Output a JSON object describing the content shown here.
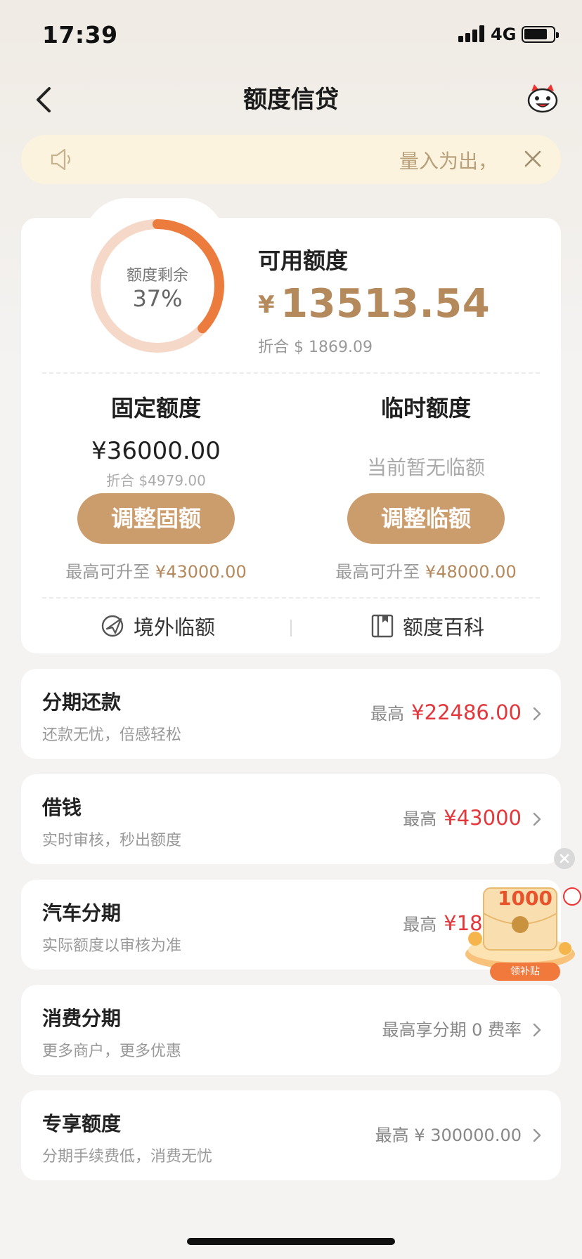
{
  "status": {
    "time": "17:39",
    "network": "4G"
  },
  "nav": {
    "title": "额度信贷"
  },
  "notice": {
    "text": "量入为出，"
  },
  "credit": {
    "ring_label": "额度剩余",
    "ring_percent": "37%",
    "ring_fraction": 0.37,
    "available_title": "可用额度",
    "available_symbol": "¥",
    "available_amount": "13513.54",
    "available_converted": "折合 $ 1869.09",
    "fixed": {
      "title": "固定额度",
      "amount": "¥36000.00",
      "converted": "折合 $4979.00",
      "button": "调整固额",
      "max_prefix": "最高可升至",
      "max_value": "¥43000.00"
    },
    "temp": {
      "title": "临时额度",
      "none_text": "当前暂无临额",
      "button": "调整临额",
      "max_prefix": "最高可升至",
      "max_value": "¥48000.00"
    },
    "links": {
      "overseas": "境外临额",
      "wiki": "额度百科"
    }
  },
  "rows": [
    {
      "title": "分期还款",
      "sub": "还款无忧，倍感轻松",
      "prefix": "最高",
      "amount": "¥22486.00"
    },
    {
      "title": "借钱",
      "sub": "实时审核，秒出额度",
      "prefix": "最高",
      "amount": "¥43000"
    },
    {
      "title": "汽车分期",
      "sub": "实际额度以审核为准",
      "prefix": "最高",
      "amount": "¥18000"
    },
    {
      "title": "消费分期",
      "sub": "更多商户，更多优惠",
      "text": "最高享分期 0 费率"
    },
    {
      "title": "专享额度",
      "sub": "分期手续费低，消费无忧",
      "text": "最高 ¥ 300000.00"
    }
  ],
  "ad": {
    "amount": "1000",
    "button": "领补贴"
  },
  "colors": {
    "accent": "#cc9d6c",
    "gold_text": "#b4895c",
    "ring": "#ec7b3e",
    "ring_track": "#f6d8c8",
    "red": "#e3373b"
  }
}
